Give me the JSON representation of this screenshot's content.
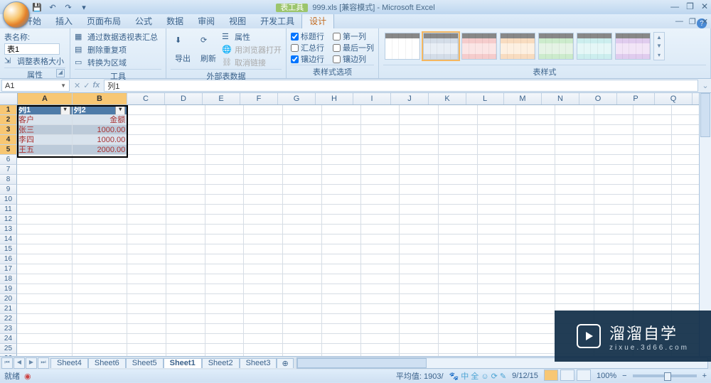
{
  "title": {
    "tool_label": "表工具",
    "doc": "999.xls [兼容模式] - Microsoft Excel"
  },
  "qat": {
    "save": "💾",
    "undo": "↶",
    "redo": "↷",
    "more": "▾"
  },
  "win": {
    "min": "—",
    "max": "❐",
    "close": "✕"
  },
  "doc_win": {
    "min": "—",
    "max": "❐",
    "close": "✕"
  },
  "tabs": [
    "开始",
    "插入",
    "页面布局",
    "公式",
    "数据",
    "审阅",
    "视图",
    "开发工具",
    "设计"
  ],
  "active_tab": "设计",
  "ribbon": {
    "props": {
      "name_label": "表名称:",
      "table_name": "表1",
      "resize": "调整表格大小",
      "title": "属性"
    },
    "tools": {
      "pivot": "通过数据透视表汇总",
      "dedup": "删除重复项",
      "range": "转换为区域",
      "title": "工具"
    },
    "ext": {
      "export": "导出",
      "refresh": "刷新",
      "props": "属性",
      "browser": "用浏览器打开",
      "unlink": "取消链接",
      "title": "外部表数据"
    },
    "opts": {
      "c1": "标题行",
      "c2": "汇总行",
      "c3": "镶边行",
      "c4": "第一列",
      "c5": "最后一列",
      "c6": "镶边列",
      "title": "表样式选项"
    },
    "styles": {
      "title": "表样式"
    }
  },
  "formula": {
    "name": "A1",
    "value": "列1"
  },
  "columns": [
    "A",
    "B",
    "C",
    "D",
    "E",
    "F",
    "G",
    "H",
    "I",
    "J",
    "K",
    "L",
    "M",
    "N",
    "O",
    "P",
    "Q"
  ],
  "sel_cols": [
    "A",
    "B"
  ],
  "rows": 26,
  "sel_rows": [
    1,
    2,
    3,
    4,
    5
  ],
  "table": {
    "header": [
      "列1",
      "列2"
    ],
    "r2": [
      "客户",
      "金额"
    ],
    "r3": [
      "张三",
      "1000.00"
    ],
    "r4": [
      "李四",
      "1000.00"
    ],
    "r5": [
      "王五",
      "2000.00"
    ]
  },
  "sheet_tabs": [
    "Sheet4",
    "Sheet6",
    "Sheet5",
    "Sheet1",
    "Sheet2",
    "Sheet3"
  ],
  "active_sheet": "Sheet1",
  "status": {
    "ready": "就绪",
    "rec": "◉",
    "avg_label": "平均值:",
    "avg": "1903/",
    "count": "9/12/15"
  },
  "zoom": "100%",
  "watermark": {
    "brand": "溜溜自学",
    "url": "zixue.3d66.com"
  },
  "style_colors": [
    [
      "#fff",
      "#fff",
      "#fff"
    ],
    [
      "#e8eef5",
      "#d4dde8",
      "#e8eef5"
    ],
    [
      "#fbe5e5",
      "#f5cccc",
      "#fbe5e5"
    ],
    [
      "#fdf0e1",
      "#f8dcc0",
      "#fdf0e1"
    ],
    [
      "#e5f3e5",
      "#ccebcc",
      "#e5f3e5"
    ],
    [
      "#e5f7f7",
      "#cceeee",
      "#e5f7f7"
    ],
    [
      "#f2e5f7",
      "#e0ccee",
      "#f2e5f7"
    ]
  ]
}
